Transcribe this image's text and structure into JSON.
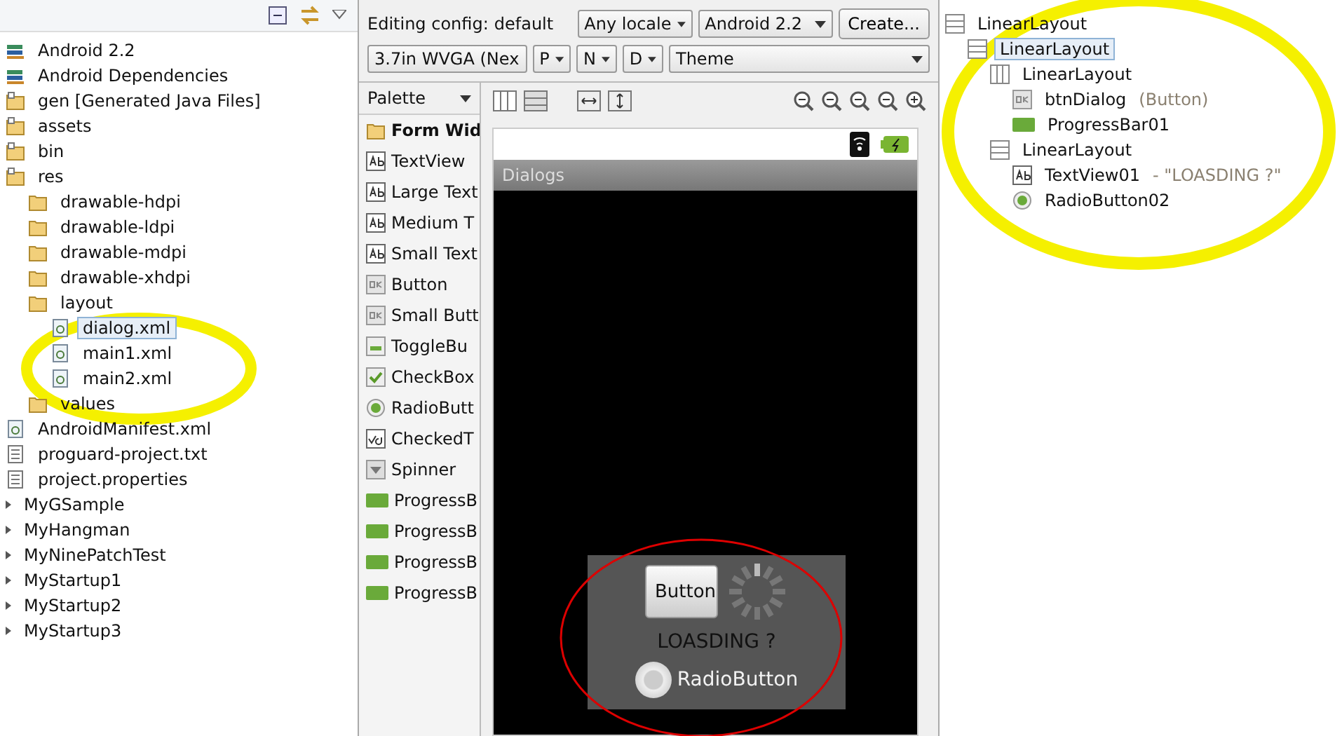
{
  "explorer": {
    "items": [
      {
        "children": [
          {
            "label": "Android 2.2",
            "kind": "library",
            "selected": false
          },
          {
            "label": "Android Dependencies",
            "kind": "library",
            "selected": false
          },
          {
            "label": "gen [Generated Java Files]",
            "kind": "source-folder",
            "selected": false
          },
          {
            "label": "assets",
            "kind": "source-folder",
            "selected": false
          },
          {
            "label": "bin",
            "kind": "source-folder",
            "selected": false
          },
          {
            "label": "res",
            "kind": "source-folder",
            "selected": false,
            "children": [
              {
                "label": "drawable-hdpi",
                "kind": "folder",
                "selected": false
              },
              {
                "label": "drawable-ldpi",
                "kind": "folder",
                "selected": false
              },
              {
                "label": "drawable-mdpi",
                "kind": "folder",
                "selected": false
              },
              {
                "label": "drawable-xhdpi",
                "kind": "folder",
                "selected": false
              },
              {
                "label": "layout",
                "kind": "folder",
                "selected": false,
                "children": [
                  {
                    "label": "dialog.xml",
                    "kind": "xml",
                    "selected": true
                  },
                  {
                    "label": "main1.xml",
                    "kind": "xml",
                    "selected": false
                  },
                  {
                    "label": "main2.xml",
                    "kind": "xml",
                    "selected": false
                  }
                ]
              },
              {
                "label": "values",
                "kind": "folder",
                "selected": false
              }
            ]
          },
          {
            "label": "AndroidManifest.xml",
            "kind": "xml",
            "selected": false
          },
          {
            "label": "proguard-project.txt",
            "kind": "text",
            "selected": false
          },
          {
            "label": "project.properties",
            "kind": "text",
            "selected": false
          }
        ]
      },
      {
        "label": "MyGSample",
        "kind": "project",
        "selected": false
      },
      {
        "label": "MyHangman",
        "kind": "project",
        "selected": false
      },
      {
        "label": "MyNinePatchTest",
        "kind": "project",
        "selected": false
      },
      {
        "label": "MyStartup1",
        "kind": "project",
        "selected": false
      },
      {
        "label": "MyStartup2",
        "kind": "project",
        "selected": false
      },
      {
        "label": "MyStartup3",
        "kind": "project",
        "selected": false
      }
    ]
  },
  "config": {
    "label": "Editing config:",
    "value": "default",
    "row1": [
      "Any locale",
      "Android 2.2"
    ],
    "create_button": "Create...",
    "row2": [
      "3.7in WVGA (Nex",
      "P",
      "N",
      "D",
      "Theme"
    ]
  },
  "palette": {
    "title": "Palette",
    "group": "Form Wid",
    "items": [
      {
        "label": "TextView",
        "kind": "text"
      },
      {
        "label": "Large Text",
        "kind": "text"
      },
      {
        "label": "Medium T",
        "kind": "text"
      },
      {
        "label": "Small Text",
        "kind": "text"
      },
      {
        "label": "Button",
        "kind": "button"
      },
      {
        "label": "Small Butt",
        "kind": "button"
      },
      {
        "label": "ToggleBu",
        "kind": "toggle"
      },
      {
        "label": "CheckBox",
        "kind": "checkbox"
      },
      {
        "label": "RadioButt",
        "kind": "radio"
      },
      {
        "label": "CheckedT",
        "kind": "checked-text"
      },
      {
        "label": "Spinner",
        "kind": "spinner"
      },
      {
        "label": "ProgressB",
        "kind": "progress"
      },
      {
        "label": "ProgressB",
        "kind": "progress"
      },
      {
        "label": "ProgressB",
        "kind": "progress"
      },
      {
        "label": "ProgressB",
        "kind": "progress"
      }
    ]
  },
  "device": {
    "app_title": "Dialogs",
    "dialog": {
      "button": "Button",
      "text": "LOASDING ?",
      "radio": {
        "label": "RadioButton",
        "checked": false
      }
    }
  },
  "outline": {
    "items": [
      {
        "label": "LinearLayout",
        "kind": "vertical",
        "selected": false,
        "children": [
          {
            "label": "LinearLayout",
            "kind": "vertical",
            "selected": true,
            "children": [
              {
                "label": "LinearLayout",
                "kind": "horizontal",
                "selected": false,
                "children": [
                  {
                    "label": "btnDialog",
                    "detail": "(Button)",
                    "kind": "button",
                    "selected": false
                  },
                  {
                    "label": "ProgressBar01",
                    "kind": "progress",
                    "selected": false
                  }
                ]
              },
              {
                "label": "LinearLayout",
                "kind": "vertical",
                "selected": false,
                "children": [
                  {
                    "label": "TextView01",
                    "detail": "- \"LOASDING ?\"",
                    "kind": "text",
                    "selected": false
                  },
                  {
                    "label": "RadioButton02",
                    "kind": "radio",
                    "selected": false
                  }
                ]
              }
            ]
          }
        ]
      }
    ]
  }
}
